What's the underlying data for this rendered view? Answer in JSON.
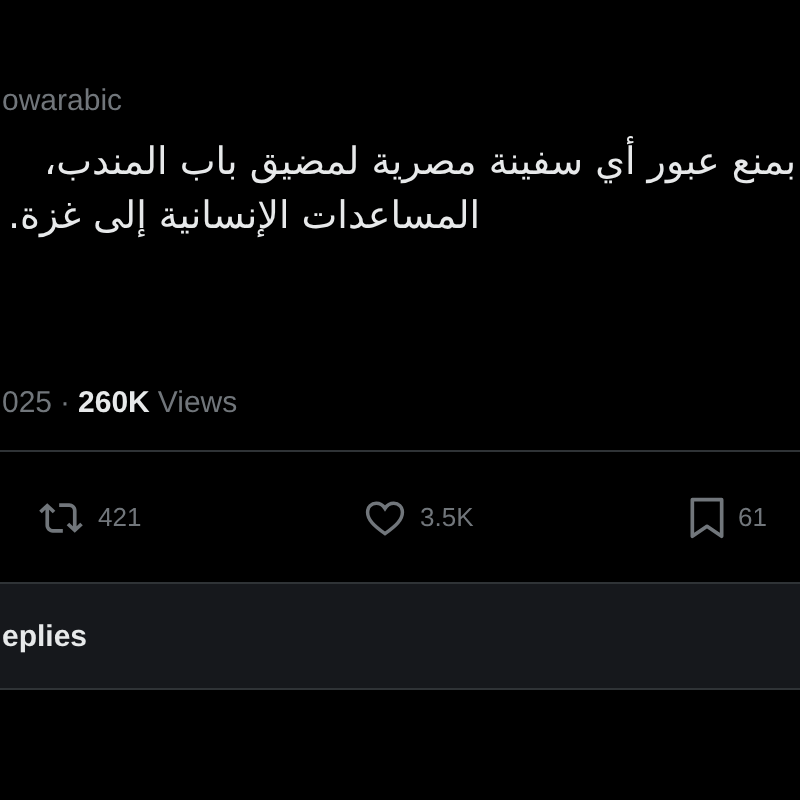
{
  "post": {
    "handle": "owarabic",
    "text_lines": [
      "بمنع عبور أي سفينة مصرية لمضيق باب المندب،",
      "المساعدات الإنسانية إلى غزة."
    ],
    "date": "025",
    "separator": "·",
    "views_count": "260K",
    "views_label": "Views"
  },
  "actions": [
    {
      "kind": "repost",
      "count": "421"
    },
    {
      "kind": "like",
      "count": "3.5K"
    },
    {
      "kind": "bookmark",
      "count": "61"
    }
  ],
  "replies_tab": {
    "label": "eplies"
  }
}
